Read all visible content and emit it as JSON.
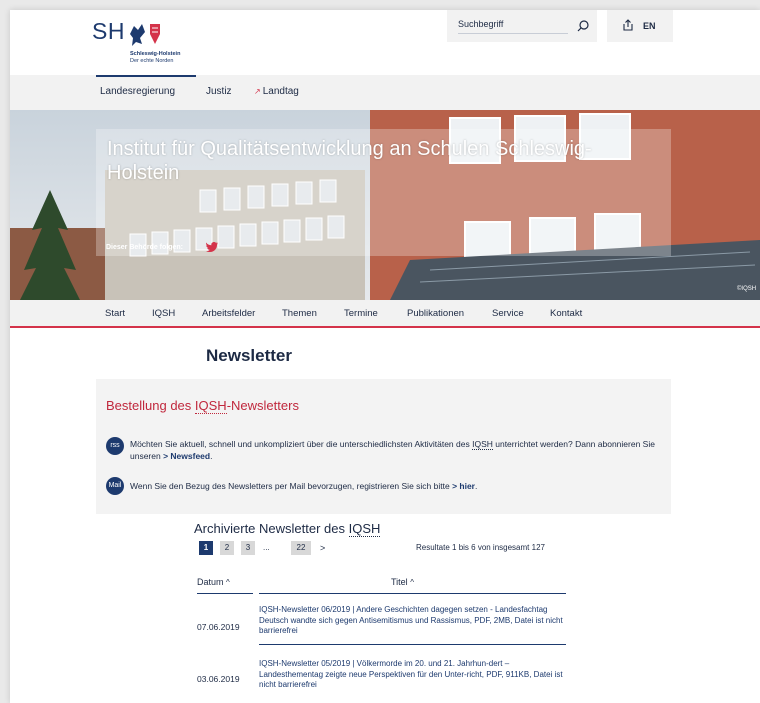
{
  "header": {
    "logo_text": "SH",
    "logo_name": "Schleswig-Holstein",
    "logo_tagline": "Der echte Norden",
    "search_placeholder": "Suchbegriff",
    "language": "EN"
  },
  "topnav": {
    "items": [
      "Landesregierung",
      "Justiz",
      "Landtag"
    ]
  },
  "hero": {
    "title": "Institut für Qualitätsentwicklung an Schulen Schleswig-Holstein",
    "follow_label": "Dieser Behörde folgen:",
    "copyright": "©IQSH"
  },
  "mainnav": {
    "items": [
      "Start",
      "IQSH",
      "Arbeitsfelder",
      "Themen",
      "Termine",
      "Publikationen",
      "Service",
      "Kontakt"
    ]
  },
  "main": {
    "page_title": "Newsletter",
    "order_panel": {
      "title_prefix": "Bestellung des ",
      "title_acronym": "IQSH",
      "title_suffix": "-Newsletters",
      "rss_badge": "rss",
      "rss_text_1": "Möchten Sie aktuell, schnell und unkompliziert über die unterschiedlichsten Aktivitäten des ",
      "rss_acronym": "IQSH",
      "rss_text_2": " unterrichtet werden? Dann abonnieren Sie unseren ",
      "rss_link": "> Newsfeed",
      "rss_end": ".",
      "mail_badge": "Mail",
      "mail_text": "Wenn Sie den Bezug des Newsletters per Mail bevorzugen, registrieren Sie sich bitte ",
      "mail_link": "> hier",
      "mail_end": "."
    },
    "archive": {
      "title_prefix": "Archivierte Newsletter des ",
      "title_acronym": "IQSH",
      "pages": [
        "1",
        "2",
        "3"
      ],
      "ellipsis": "...",
      "last_page": "22",
      "next": ">",
      "results": "Resultate 1 bis 6 von insgesamt 127",
      "columns": {
        "date": "Datum",
        "title": "Titel"
      },
      "sort_icon": "^",
      "rows": [
        {
          "date": "07.06.2019",
          "title": "IQSH-Newsletter 06/2019 | Andere Geschichten dagegen setzen - Landesfachtag Deutsch wandte sich gegen Antisemitismus und Rassismus, PDF, 2MB, Datei ist nicht barrierefrei"
        },
        {
          "date": "03.06.2019",
          "title": "IQSH-Newsletter 05/2019 | Völkermorde im 20. und 21. Jahrhun-dert – Landesthementag zeigte neue Perspektiven für den Unter-richt, PDF, 911KB, Datei ist nicht barrierefrei"
        }
      ]
    }
  },
  "colors": {
    "brand_blue": "#1d3a6e",
    "accent_red": "#d4334a",
    "panel_bg": "#f3f3f3"
  }
}
